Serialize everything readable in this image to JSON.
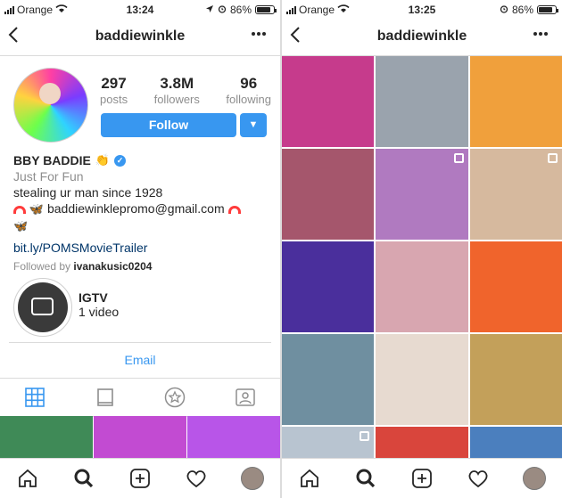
{
  "left": {
    "status": {
      "carrier": "Orange",
      "time": "13:24",
      "battery": "86%",
      "battery_level": 0.86
    },
    "nav": {
      "title": "baddiewinkle"
    },
    "stats": [
      {
        "value": "297",
        "label": "posts"
      },
      {
        "value": "3.8M",
        "label": "followers"
      },
      {
        "value": "96",
        "label": "following"
      }
    ],
    "follow_label": "Follow",
    "bio": {
      "name": "BBY BADDIE",
      "category": "Just For Fun",
      "line1": "stealing ur man since 1928",
      "email_line": "baddiewinklepromo@gmail.com",
      "link": "bit.ly/POMSMovieTrailer",
      "followed_prefix": "Followed by",
      "followed_user": "ivanakusic0204"
    },
    "igtv": {
      "title": "IGTV",
      "count": "1 video"
    },
    "email_button": "Email",
    "strip_colors": [
      "#3f8a57",
      "#c24bd2",
      "#b855e8"
    ]
  },
  "right": {
    "status": {
      "carrier": "Orange",
      "time": "13:25",
      "battery": "86%",
      "battery_level": 0.86
    },
    "nav": {
      "title": "baddiewinkle"
    },
    "grid": [
      {
        "color": "#c63b8c",
        "multi": false
      },
      {
        "color": "#9aa3ad",
        "multi": false
      },
      {
        "color": "#f0a03c",
        "multi": false
      },
      {
        "color": "#a5566c",
        "multi": false
      },
      {
        "color": "#b07ac0",
        "multi": true
      },
      {
        "color": "#d6b99e",
        "multi": true
      },
      {
        "color": "#4a2f9c",
        "multi": false
      },
      {
        "color": "#d8a6b0",
        "multi": false
      },
      {
        "color": "#f0642c",
        "multi": false
      },
      {
        "color": "#6f8fa0",
        "multi": false
      },
      {
        "color": "#e7dad0",
        "multi": false
      },
      {
        "color": "#c3a05a",
        "multi": false
      },
      {
        "color": "#b8c4d0",
        "multi": true
      },
      {
        "color": "#d9453c",
        "multi": false
      },
      {
        "color": "#4b7fbe",
        "multi": false
      }
    ]
  }
}
